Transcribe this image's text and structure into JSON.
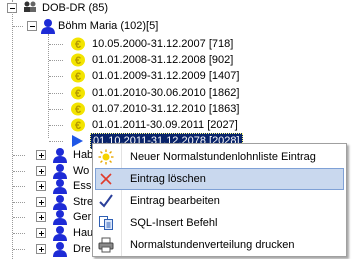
{
  "tree": {
    "root_label": "DOB-DR (85)",
    "person_label": "Böhm Maria (102)[5]",
    "entries": [
      "10.05.2000-31.12.2007 [718]",
      "01.01.2008-31.12.2008 [902]",
      "01.01.2009-31.12.2009 [1407]",
      "01.01.2010-30.06.2010 [1862]",
      "01.07.2010-31.12.2010 [1863]",
      "01.01.2011-30.09.2011 [2027]",
      "01.10.2011-31.12.2078 [2028]"
    ],
    "selected_index": 6,
    "collapsed_partial": [
      "Hab",
      "Wo",
      "Ess",
      "Stre",
      "Ger",
      "Hau",
      "Dre"
    ]
  },
  "context_menu": {
    "items": [
      {
        "label": "Neuer Normalstundenlohnliste Eintrag",
        "icon": "sun-icon"
      },
      {
        "label": "Eintrag löschen",
        "icon": "delete-cross-icon"
      },
      {
        "label": "Eintrag bearbeiten",
        "icon": "checkmark-pen-icon"
      },
      {
        "label": "SQL-Insert Befehl",
        "icon": "copy-documents-icon"
      },
      {
        "label": "Normalstundenverteilung drucken",
        "icon": "printer-icon"
      }
    ],
    "highlighted_index": 1
  },
  "colors": {
    "selection": "#0a246a",
    "menu_highlight": "#c9d8ee",
    "person_icon": "#1d2bd6",
    "coin_icon": "#f3e400",
    "arrow": "#1f57e6"
  }
}
